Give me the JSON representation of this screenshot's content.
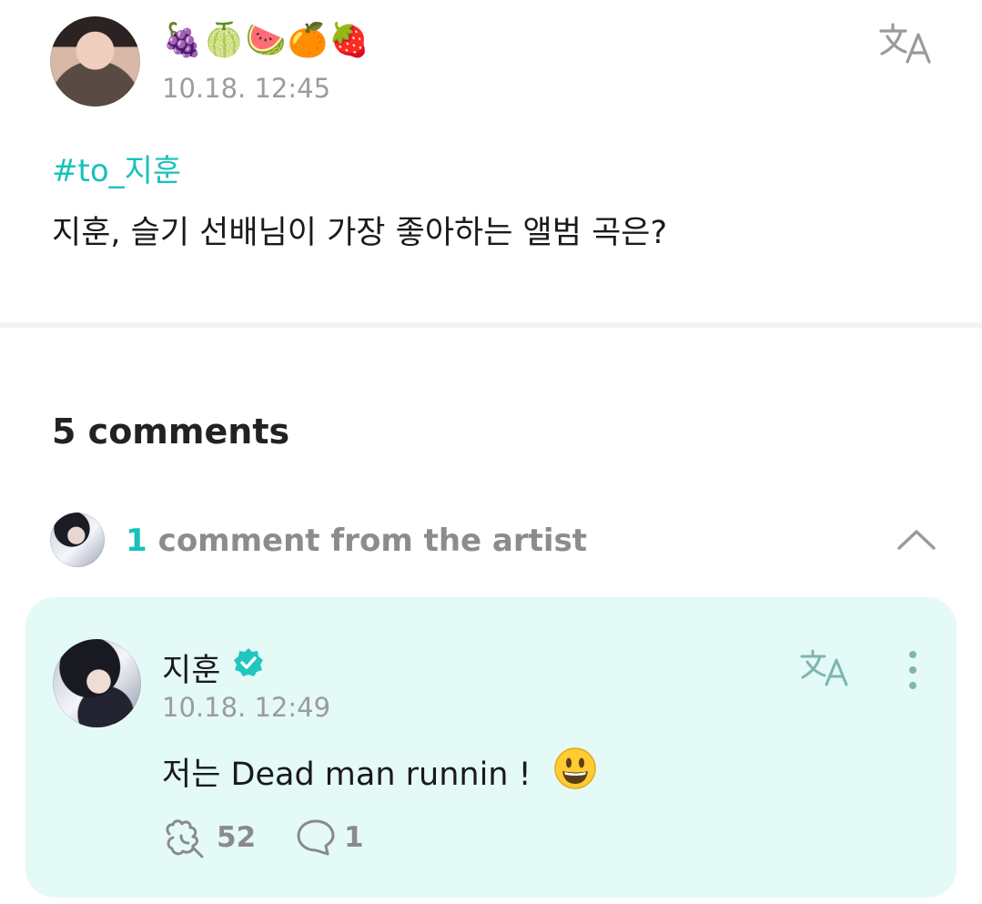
{
  "post": {
    "author_name": "🍇🍈🍉🍊🍓",
    "timestamp": "10.18. 12:45",
    "hashtag": "#to_지훈",
    "body": "지훈, 슬기 선배님이 가장 좋아하는 앨범 곡은?",
    "translate_icon": "translate-icon"
  },
  "comments": {
    "count_label": "5 comments",
    "artist_summary": {
      "count": "1",
      "label": "comment from the artist",
      "toggle_icon": "chevron-up-icon"
    },
    "items": [
      {
        "author": "지훈",
        "verified": true,
        "timestamp": "10.18. 12:49",
        "text": "저는 Dead man runnin !",
        "emoji": "😃",
        "likes": "52",
        "replies": "1"
      }
    ]
  },
  "colors": {
    "accent": "#18c1bb",
    "card_bg": "#e4faf7",
    "muted_text": "#9c9c9c"
  }
}
